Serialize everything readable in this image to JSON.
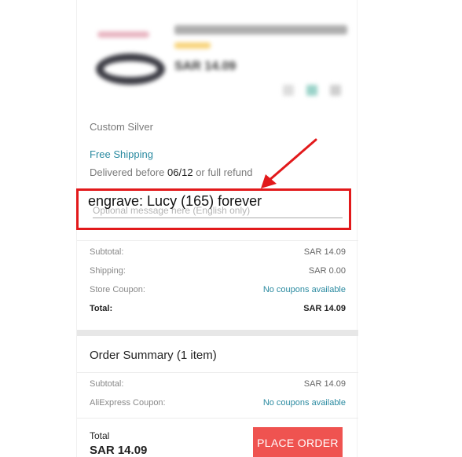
{
  "product": {
    "price": "SAR 14.09"
  },
  "order": {
    "variant": "Custom Silver",
    "shipping_method": "Free Shipping",
    "delivery_prefix": "Delivered before",
    "delivery_date": "06/12",
    "delivery_suffix": "or full refund",
    "message_placeholder": "Optional message here (English only)"
  },
  "store_totals": [
    {
      "label": "Subtotal:",
      "value": "SAR 14.09"
    },
    {
      "label": "Shipping:",
      "value": "SAR 0.00"
    },
    {
      "label": "Store Coupon:",
      "value": "No coupons available"
    },
    {
      "label": "Total:",
      "value": "SAR 14.09"
    }
  ],
  "summary": {
    "title": "Order Summary (1 item)",
    "rows": [
      {
        "label": "Subtotal:",
        "value": "SAR 14.09"
      },
      {
        "label": "AliExpress Coupon:",
        "value": "No coupons available"
      }
    ]
  },
  "footer": {
    "total_label": "Total",
    "total_value": "SAR 14.09",
    "place_order_label": "PLACE ORDER"
  },
  "annotation": {
    "text": "engrave: Lucy (165) forever",
    "color": "#e2191b"
  },
  "colors": {
    "link": "#2a8aa0",
    "button": "#ef5350"
  },
  "icons": [
    "arrow-annotation-icon"
  ]
}
